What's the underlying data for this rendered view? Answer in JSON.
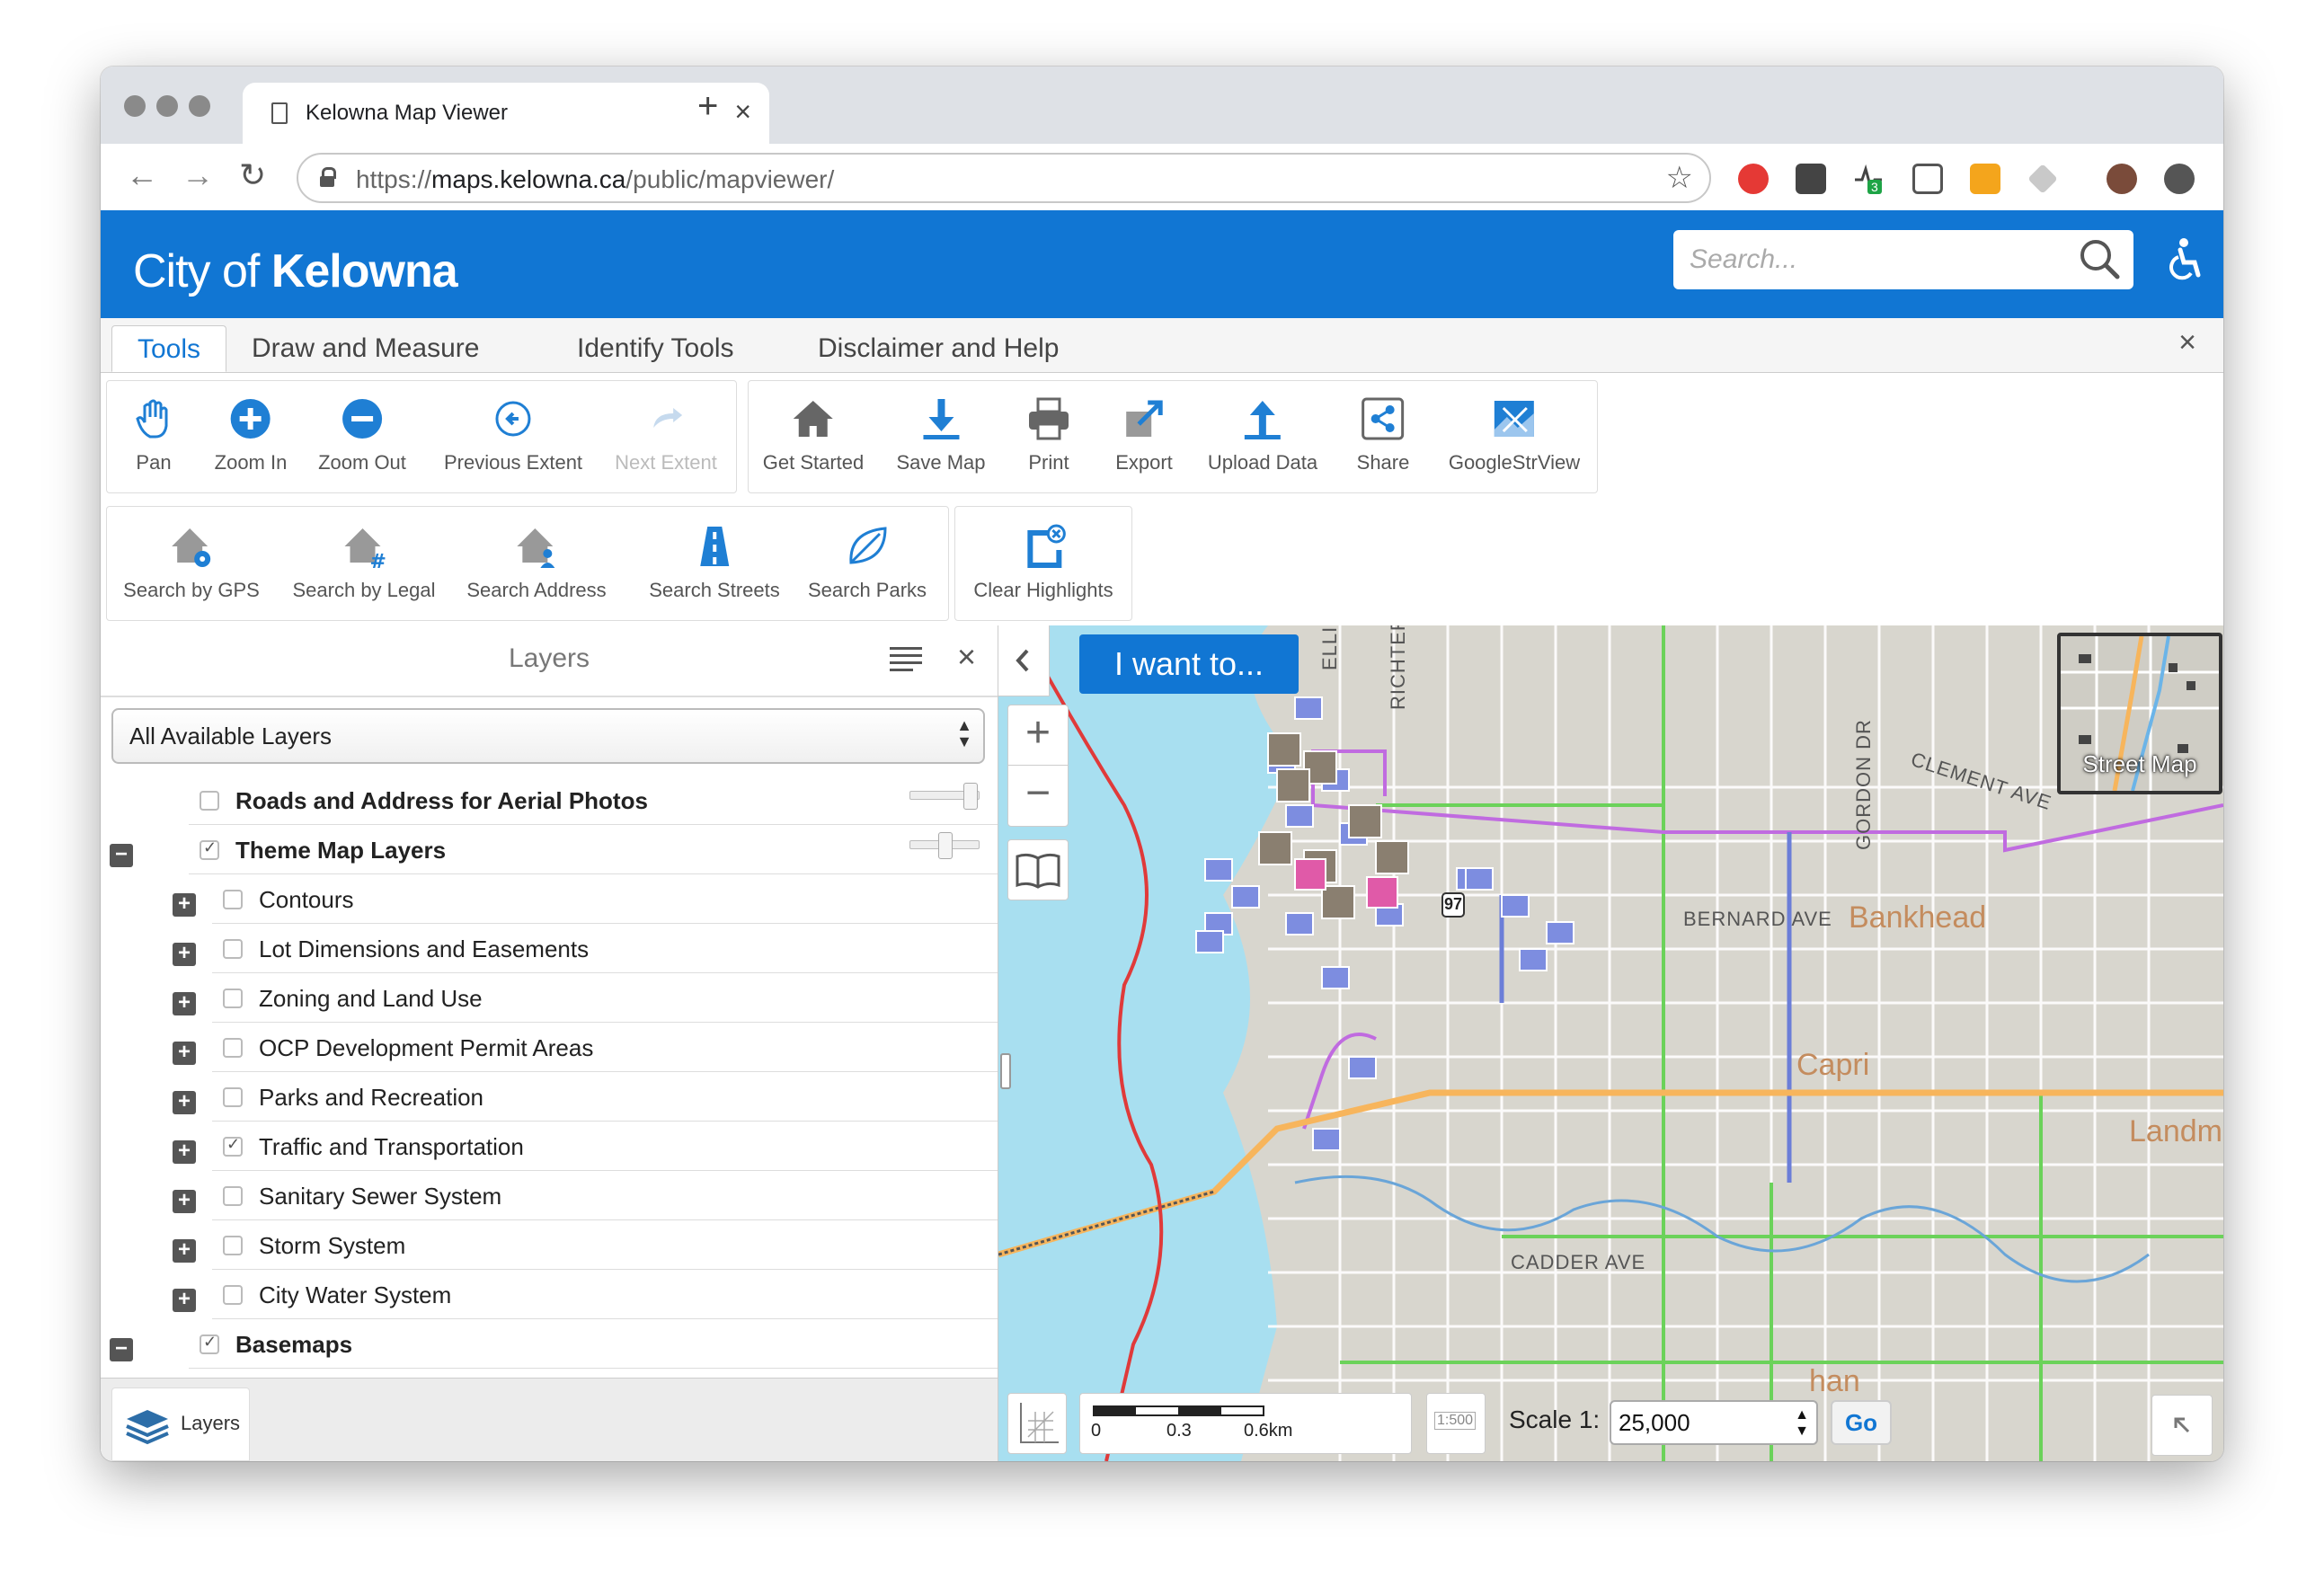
{
  "browser": {
    "tab_title": "Kelowna Map Viewer",
    "tab_close": "×",
    "new_tab": "+",
    "url_scheme": "https://",
    "url_host": "maps.kelowna.ca",
    "url_path": "/public/mapviewer/",
    "back": "←",
    "forward": "→",
    "reload": "↻",
    "star": "☆",
    "extension_badge": "3"
  },
  "header": {
    "logo_prefix": "City of ",
    "logo_name": "Kelowna",
    "search_placeholder": "Search...",
    "brand_color": "#1176d3"
  },
  "ribbon_tabs": [
    "Tools",
    "Draw and Measure",
    "Identify Tools",
    "Disclaimer and Help"
  ],
  "ribbon_close": "×",
  "tools_row1": {
    "navigation": [
      "Pan",
      "Zoom In",
      "Zoom Out",
      "Previous Extent",
      "Next Extent"
    ],
    "actions": [
      "Get Started",
      "Save Map",
      "Print",
      "Export",
      "Upload Data",
      "Share",
      "GoogleStrView"
    ]
  },
  "tools_row2": {
    "search": [
      "Search by GPS",
      "Search by Legal",
      "Search Address",
      "Search Streets",
      "Search Parks"
    ],
    "clear": [
      "Clear Highlights"
    ]
  },
  "layers_panel": {
    "title": "Layers",
    "close": "×",
    "filter_selected": "All Available Layers",
    "footer_button": "Layers",
    "items": [
      {
        "label": "Roads and Address for Aerial Photos",
        "checked": false,
        "bold": true,
        "level": 0,
        "opacity": 0.95
      },
      {
        "label": "Theme Map Layers",
        "checked": true,
        "bold": true,
        "level": 0,
        "expander": "−",
        "opacity": 0.5
      },
      {
        "label": "Contours",
        "checked": false,
        "bold": false,
        "level": 1,
        "expander": "+"
      },
      {
        "label": "Lot Dimensions and Easements",
        "checked": false,
        "bold": false,
        "level": 1,
        "expander": "+"
      },
      {
        "label": "Zoning and Land Use",
        "checked": false,
        "bold": false,
        "level": 1,
        "expander": "+"
      },
      {
        "label": "OCP Development Permit Areas",
        "checked": false,
        "bold": false,
        "level": 1,
        "expander": "+"
      },
      {
        "label": "Parks and Recreation",
        "checked": false,
        "bold": false,
        "level": 1,
        "expander": "+"
      },
      {
        "label": "Traffic and Transportation",
        "checked": true,
        "bold": false,
        "level": 1,
        "expander": "+"
      },
      {
        "label": "Sanitary Sewer System",
        "checked": false,
        "bold": false,
        "level": 1,
        "expander": "+"
      },
      {
        "label": "Storm System",
        "checked": false,
        "bold": false,
        "level": 1,
        "expander": "+"
      },
      {
        "label": "City Water System",
        "checked": false,
        "bold": false,
        "level": 1,
        "expander": "+"
      },
      {
        "label": "Basemaps",
        "checked": true,
        "bold": true,
        "level": 0,
        "expander": "−"
      }
    ]
  },
  "map": {
    "i_want_to": "I want to...",
    "zoom_in": "+",
    "zoom_out": "−",
    "collapse": "‹",
    "basemap_label": "Street Map",
    "street_labels": [
      "ELLIS ST",
      "RICHTER ST",
      "CLEMENT AVE",
      "GORDON DR",
      "BERNARD AVE",
      "CADDER AVE"
    ],
    "area_labels": [
      "Bankhead",
      "Capri",
      "Landma",
      "han"
    ],
    "highway_shield": "97",
    "scalebar": {
      "ticks": [
        "0",
        "0.3",
        "0.6km"
      ]
    },
    "scale_label": "Scale 1:",
    "scale_value": "25,000",
    "scale_icon_text": "1:500",
    "go_button": "Go",
    "colors": {
      "water": "#a8dff0",
      "land": "#d8d6ce",
      "arterial": "#f7b55c",
      "bike_route": "#6bd25a",
      "transit": "#6b7ed8",
      "boundary": "#d94d4d"
    }
  }
}
